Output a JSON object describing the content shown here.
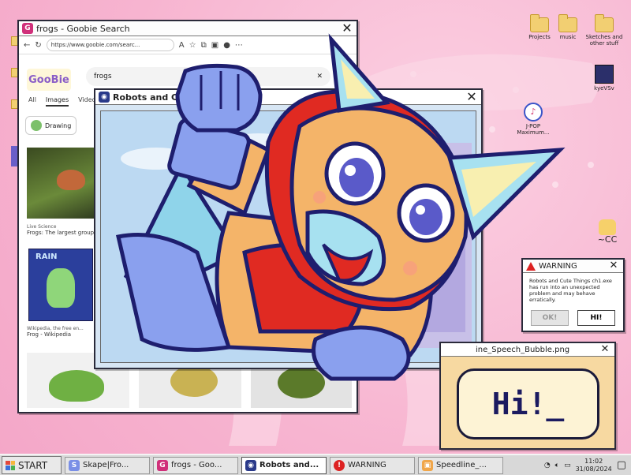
{
  "desktop": {
    "icons": [
      {
        "label": "Projects"
      },
      {
        "label": "music"
      },
      {
        "label": "Sketches and other stuff"
      },
      {
        "label": "kyeVSv"
      },
      {
        "label": "J-POP Maximum..."
      },
      {
        "label": "~CC"
      }
    ]
  },
  "browser": {
    "title": "frogs - Goobie Search",
    "url": "https://www.goobie.com/searc...",
    "logo": "GooBie",
    "query": "frogs",
    "tabs": [
      "All",
      "Images",
      "Videos"
    ],
    "chip_label": "Drawing",
    "results": [
      {
        "source": "Live Science",
        "title": "Frogs: The largest group..."
      },
      {
        "source": "Wikipedia, the free en...",
        "title": "Frog - Wikipedia"
      }
    ],
    "drawing_text": "RAIN"
  },
  "robots_window": {
    "title": "Robots and Cute"
  },
  "warning": {
    "title": "WARNING",
    "message": "Robots and Cute Things ch1.exe has run into an unexpected problem and may behave erratically.",
    "ok_label": "OK!",
    "hi_label": "HI!"
  },
  "speech_window": {
    "title": "ine_Speech_Bubble.png",
    "bubble_text": "Hi!_"
  },
  "taskbar": {
    "start_label": "START",
    "tasks": [
      {
        "label": "Skape|Fro...",
        "icon": "skape-icon"
      },
      {
        "label": "frogs - Goo...",
        "icon": "goobie-icon"
      },
      {
        "label": "Robots and...",
        "icon": "robot-icon"
      },
      {
        "label": "WARNING",
        "icon": "warning-icon"
      },
      {
        "label": "Speedline_...",
        "icon": "image-icon"
      }
    ],
    "time": "11:02",
    "date": "31/08/2024"
  },
  "colors": {
    "desktop_bg": "#f7b4d0",
    "character_orange": "#f4b469",
    "character_red": "#e02a22",
    "character_blue": "#8aa0ee",
    "outline": "#1e1e6e"
  }
}
